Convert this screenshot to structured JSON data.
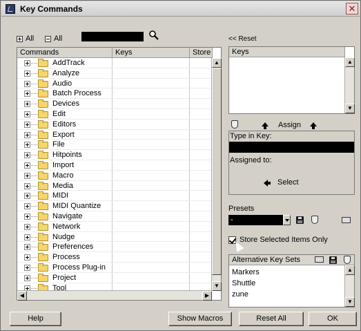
{
  "window": {
    "title": "Key Commands",
    "close_glyph": "✕"
  },
  "toolbar": {
    "expand_all": "All",
    "collapse_all": "All",
    "search_value": "",
    "reset": "<< Reset"
  },
  "commands": {
    "headers": {
      "commands": "Commands",
      "keys": "Keys",
      "store": "Store"
    },
    "items": [
      "AddTrack",
      "Analyze",
      "Audio",
      "Batch Process",
      "Devices",
      "Edit",
      "Editors",
      "Export",
      "File",
      "Hitpoints",
      "Import",
      "Macro",
      "Media",
      "MIDI",
      "MIDI Quantize",
      "Navigate",
      "Network",
      "Nudge",
      "Preferences",
      "Process",
      "Process Plug-in",
      "Project",
      "Tool"
    ]
  },
  "keys_panel": {
    "header": "Keys",
    "assign": "Assign",
    "type_in_key": "Type in Key:",
    "assigned_to": "Assigned to:",
    "select": "Select"
  },
  "presets": {
    "label": "Presets",
    "selected": "-",
    "store_selected": "Store Selected Items Only",
    "store_selected_checked": true
  },
  "alt_key_sets": {
    "header": "Alternative Key Sets",
    "items": [
      "Markers",
      "Shuttle",
      "zune"
    ]
  },
  "buttons": {
    "help": "Help",
    "show_macros": "Show Macros",
    "reset_all": "Reset All",
    "ok": "OK"
  }
}
